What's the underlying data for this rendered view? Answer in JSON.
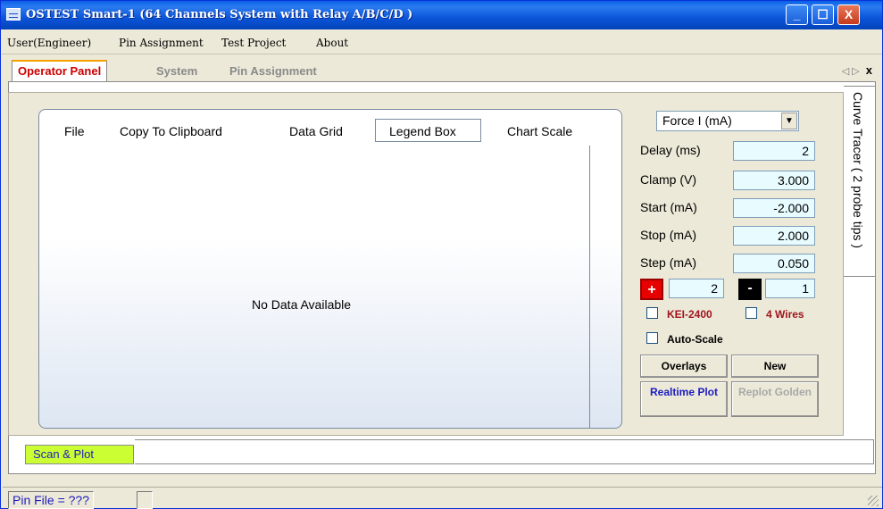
{
  "window": {
    "title": "OSTEST Smart-1 (64 Channels System with Relay A/B/C/D )",
    "minimize_glyph": "_",
    "maximize_glyph": "☐",
    "close_glyph": "X"
  },
  "menu": [
    "User(Engineer)",
    "Pin Assignment",
    "Test Project",
    "About"
  ],
  "tabs": [
    "Operator Panel",
    "System",
    "Pin Assignment"
  ],
  "tab_controls": {
    "prev": "◁",
    "next": "▷",
    "close": "x"
  },
  "chart_menu": [
    "File",
    "Copy To Clipboard",
    "Data Grid",
    "Legend Box",
    "Chart Scale"
  ],
  "chart_message": "No Data Available",
  "controls": {
    "mode": "Force I (mA)",
    "delay_label": "Delay (ms)",
    "delay_value": "2",
    "clamp_label": "Clamp (V)",
    "clamp_value": "3.000",
    "start_label": "Start (mA)",
    "start_value": "-2.000",
    "stop_label": "Stop (mA)",
    "stop_value": "2.000",
    "step_label": "Step (mA)",
    "step_value": "0.050",
    "plus_glyph": "+",
    "plus_value": "2",
    "minus_glyph": "-",
    "minus_value": "1",
    "kei_label": "KEI-2400",
    "four_wires_label": "4 Wires",
    "autoscale_label": "Auto-Scale",
    "overlays_label": "Overlays",
    "new_label": "New",
    "realtime_label": "Realtime Plot",
    "replot_label": "Replot Golden"
  },
  "side_tab": "Curve Tracer ( 2 probe tips )",
  "bottom_tab": "Scan & Plot",
  "status": {
    "pin_file": "Pin File = ???"
  },
  "colors": {
    "active_tab": "#cc0000",
    "plus": "#e60000",
    "minus": "#000000",
    "blue_text": "#1c1cc0"
  }
}
